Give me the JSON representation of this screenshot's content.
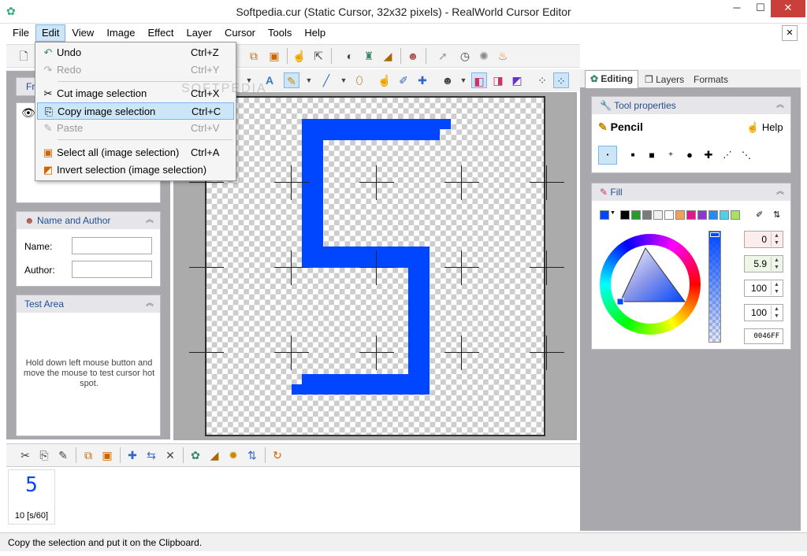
{
  "window": {
    "title": "Softpedia.cur (Static Cursor, 32x32 pixels) - RealWorld Cursor Editor",
    "minimize": "─",
    "maximize": "☐",
    "close": "✕",
    "mdi_close": "✕"
  },
  "menubar": [
    "File",
    "Edit",
    "View",
    "Image",
    "Effect",
    "Layer",
    "Cursor",
    "Tools",
    "Help"
  ],
  "edit_menu": {
    "items": [
      {
        "label": "Undo",
        "shortcut": "Ctrl+Z",
        "enabled": true,
        "icon": "undo-icon"
      },
      {
        "label": "Redo",
        "shortcut": "Ctrl+Y",
        "enabled": false,
        "icon": "redo-icon"
      },
      {
        "label": "Cut image selection",
        "shortcut": "Ctrl+X",
        "enabled": true,
        "icon": "cut-icon"
      },
      {
        "label": "Copy image selection",
        "shortcut": "Ctrl+C",
        "enabled": true,
        "highlighted": true,
        "icon": "copy-icon"
      },
      {
        "label": "Paste",
        "shortcut": "Ctrl+V",
        "enabled": false,
        "icon": "paste-icon"
      },
      {
        "label": "Select all (image selection)",
        "shortcut": "Ctrl+A",
        "enabled": true,
        "icon": "select-all-icon"
      },
      {
        "label": "Invert selection (image selection)",
        "shortcut": "",
        "enabled": true,
        "icon": "invert-selection-icon"
      }
    ]
  },
  "left_panel": {
    "first_pane_fragment": "Fr",
    "name_author": {
      "header": "Name and Author",
      "name_label": "Name:",
      "author_label": "Author:",
      "name_value": "",
      "author_value": ""
    },
    "test_area": {
      "header": "Test Area",
      "text": "Hold down left mouse button and move the mouse to test cursor hot spot."
    }
  },
  "right_panel": {
    "tabs": [
      "Editing",
      "Layers",
      "Formats"
    ],
    "tool_properties": {
      "header": "Tool properties",
      "tool_name": "Pencil",
      "help_label": "Help"
    },
    "fill": {
      "header": "Fill",
      "values": [
        "0",
        "5.9",
        "100",
        "100"
      ],
      "hex": "0046FF",
      "color": "#0046ff"
    }
  },
  "frames": {
    "frame_label": "10 [s/60]",
    "frame_glyph": "5"
  },
  "status": {
    "text": "Copy the selection and put it on the Clipboard."
  },
  "watermark": "SOFTPEDIA"
}
